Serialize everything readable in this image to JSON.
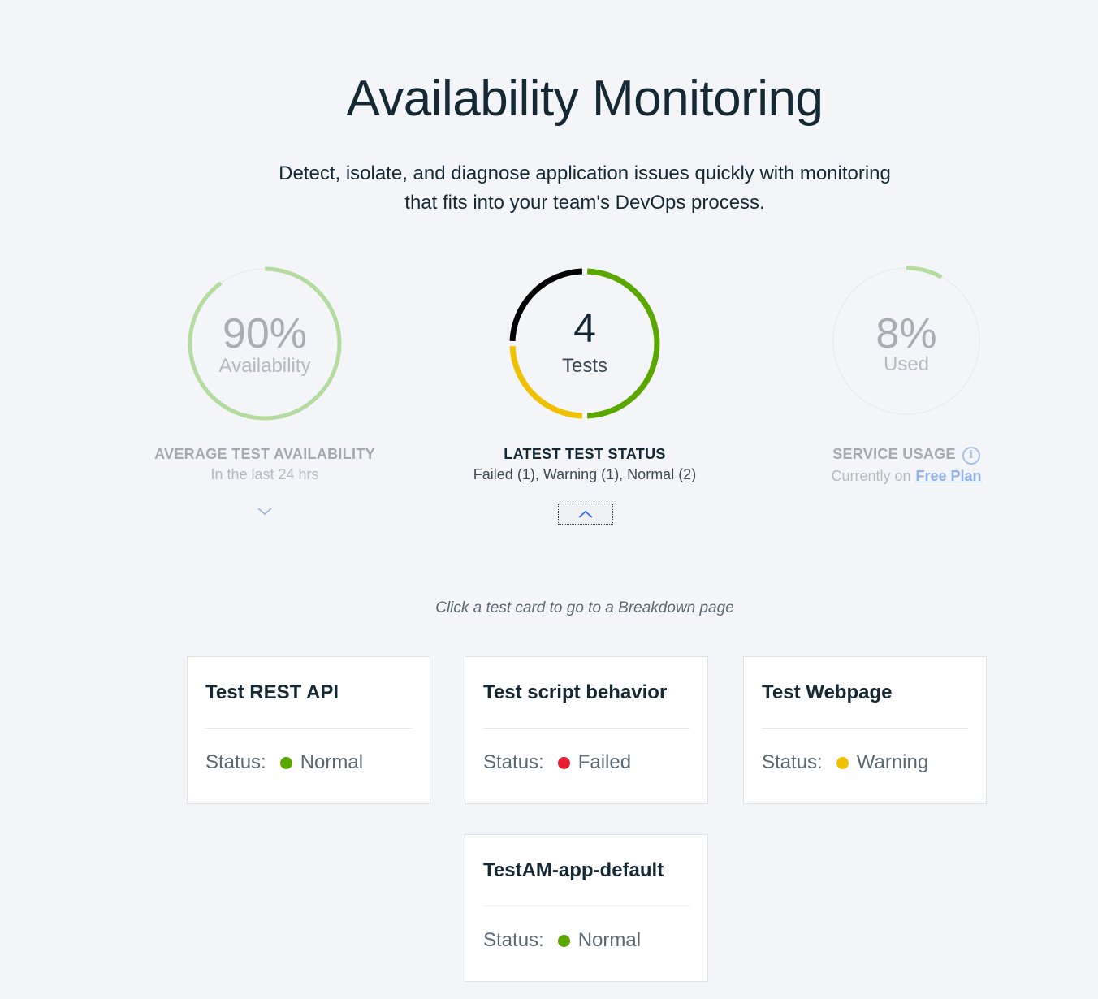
{
  "header": {
    "title": "Availability Monitoring",
    "subtitle_line1": "Detect, isolate, and diagnose application issues quickly with monitoring",
    "subtitle_line2": "that fits into your team's DevOps process."
  },
  "summary": {
    "availability": {
      "value": "90%",
      "label": "Availability",
      "fraction": 0.9,
      "title": "AVERAGE TEST AVAILABILITY",
      "sub": "In the last 24 hrs",
      "color": "#b4dc9e"
    },
    "tests": {
      "value": "4",
      "label": "Tests",
      "title": "LATEST TEST STATUS",
      "sub": "Failed (1), Warning (1), Normal (2)",
      "segments": [
        {
          "status": "Normal",
          "count": 2,
          "color": "#5aa700"
        },
        {
          "status": "Warning",
          "count": 1,
          "color": "#efc100"
        },
        {
          "status": "Failed",
          "count": 1,
          "color": "#000000"
        }
      ]
    },
    "usage": {
      "value": "8%",
      "label": "Used",
      "fraction": 0.08,
      "title": "SERVICE USAGE",
      "sub": "Currently on",
      "plan_link": "Free Plan",
      "color": "#b4dc9e"
    }
  },
  "icons": {
    "info": "info-icon",
    "chevron_down": "chevron-down-icon",
    "chevron_up": "chevron-up-icon"
  },
  "hint": "Click a test card to go to a Breakdown page",
  "status_label": "Status:",
  "cards": [
    {
      "name": "Test REST API",
      "status": "Normal",
      "color": "#5aa700"
    },
    {
      "name": "Test script behavior",
      "status": "Failed",
      "color": "#e71d32"
    },
    {
      "name": "Test Webpage",
      "status": "Warning",
      "color": "#efc100"
    },
    {
      "name": "TestAM-app-default",
      "status": "Normal",
      "color": "#5aa700"
    }
  ]
}
